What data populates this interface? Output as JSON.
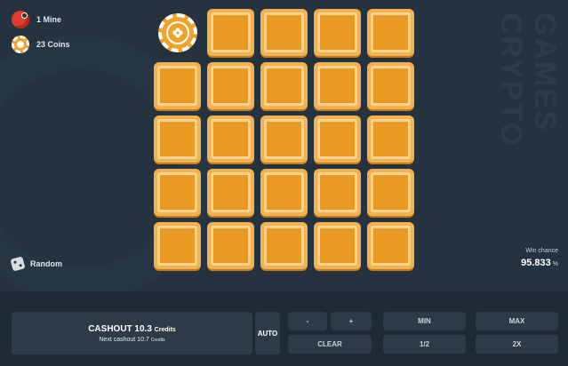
{
  "stats": {
    "mines_label": "1 Mine",
    "coins_label": "23 Coins"
  },
  "watermark": [
    "CRYPTO",
    "GAMES"
  ],
  "board": {
    "rows": 5,
    "cols": 5,
    "revealed": [
      [
        0,
        0
      ]
    ]
  },
  "random_label": "Random",
  "win_chance": {
    "label": "Win chance",
    "value": "95.833",
    "unit": "%"
  },
  "cashout": {
    "label": "CASHOUT 10.3",
    "credits": "Credits",
    "next_label": "Next cashout 10.7",
    "next_credits": "Credits"
  },
  "controls": {
    "auto": "AUTO",
    "minus": "-",
    "plus": "+",
    "min": "MIN",
    "max": "MAX",
    "clear": "CLEAR",
    "half": "1/2",
    "double": "2X"
  },
  "colors": {
    "background": "#253240",
    "tile": "#e89a24",
    "tile_border": "#f9d38f",
    "mine": "#e23c2e",
    "coin": "#f0a22c"
  }
}
